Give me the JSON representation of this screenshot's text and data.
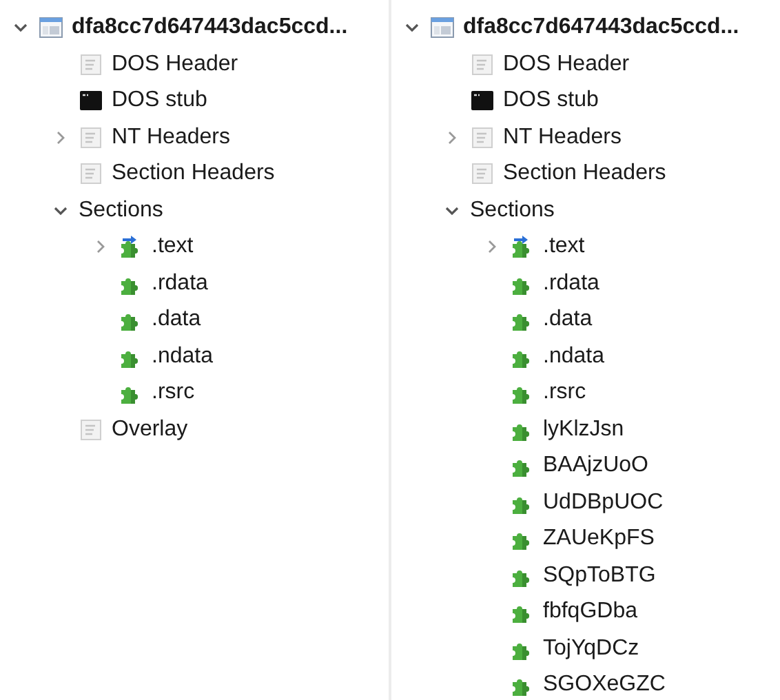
{
  "panels": [
    {
      "tree": [
        {
          "label": "dfa8cc7d647443dac5ccd...",
          "kind": "file",
          "expanded": true,
          "children": [
            {
              "label": "DOS Header",
              "kind": "header"
            },
            {
              "label": "DOS stub",
              "kind": "console"
            },
            {
              "label": "NT Headers",
              "kind": "header",
              "expanded": false
            },
            {
              "label": "Section Headers",
              "kind": "header"
            },
            {
              "label": "Sections",
              "kind": "none",
              "expanded": true,
              "children": [
                {
                  "label": ".text",
                  "kind": "entry_section",
                  "expanded": false
                },
                {
                  "label": ".rdata",
                  "kind": "section"
                },
                {
                  "label": ".data",
                  "kind": "section"
                },
                {
                  "label": ".ndata",
                  "kind": "section"
                },
                {
                  "label": ".rsrc",
                  "kind": "section"
                }
              ]
            },
            {
              "label": "Overlay",
              "kind": "header"
            }
          ]
        }
      ]
    },
    {
      "tree": [
        {
          "label": "dfa8cc7d647443dac5ccd...",
          "kind": "file",
          "expanded": true,
          "children": [
            {
              "label": "DOS Header",
              "kind": "header"
            },
            {
              "label": "DOS stub",
              "kind": "console"
            },
            {
              "label": "NT Headers",
              "kind": "header",
              "expanded": false
            },
            {
              "label": "Section Headers",
              "kind": "header"
            },
            {
              "label": "Sections",
              "kind": "none",
              "expanded": true,
              "children": [
                {
                  "label": ".text",
                  "kind": "entry_section",
                  "expanded": false
                },
                {
                  "label": ".rdata",
                  "kind": "section"
                },
                {
                  "label": ".data",
                  "kind": "section"
                },
                {
                  "label": ".ndata",
                  "kind": "section"
                },
                {
                  "label": ".rsrc",
                  "kind": "section"
                },
                {
                  "label": "lyKlzJsn",
                  "kind": "section"
                },
                {
                  "label": "BAAjzUoO",
                  "kind": "section"
                },
                {
                  "label": "UdDBpUOC",
                  "kind": "section"
                },
                {
                  "label": "ZAUeKpFS",
                  "kind": "section"
                },
                {
                  "label": "SQpToBTG",
                  "kind": "section"
                },
                {
                  "label": "fbfqGDba",
                  "kind": "section"
                },
                {
                  "label": "TojYqDCz",
                  "kind": "section"
                },
                {
                  "label": "SGOXeGZC",
                  "kind": "section"
                }
              ]
            }
          ]
        }
      ]
    }
  ]
}
